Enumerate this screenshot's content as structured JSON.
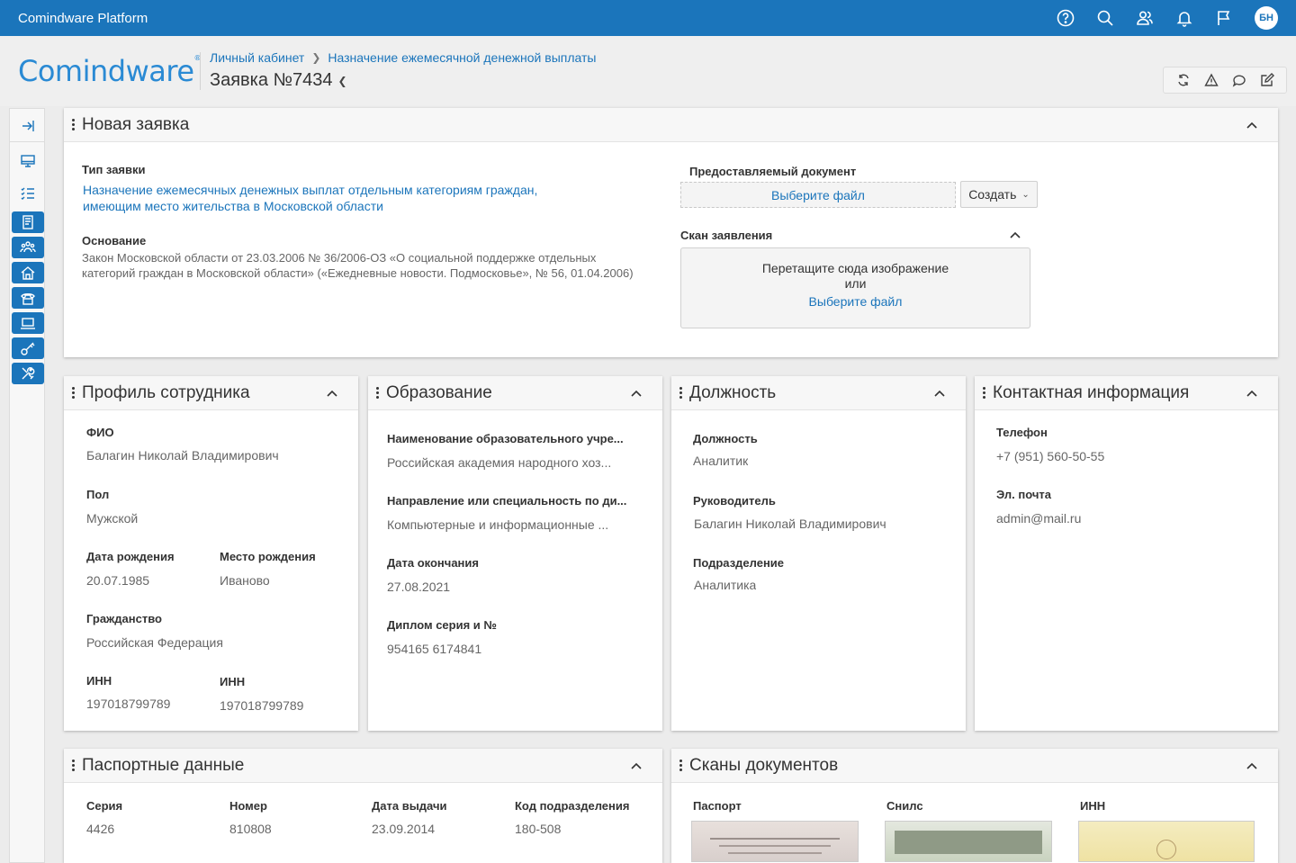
{
  "topbar": {
    "app_title": "Comindware Platform",
    "icons": [
      "help-icon",
      "search-icon",
      "users-icon",
      "bell-icon",
      "flag-icon"
    ],
    "avatar_initials": "БН"
  },
  "header": {
    "logo": "Comindware",
    "breadcrumb": [
      "Личный кабинет",
      "Назначение ежемесячной денежной выплаты"
    ],
    "title": "Заявка №7434",
    "toolbar_icons": [
      "refresh-icon",
      "warning-icon",
      "comment-icon",
      "edit-icon"
    ]
  },
  "new_request": {
    "title": "Новая заявка",
    "type_label": "Тип заявки",
    "type_value_line1": "Назначение ежемесячных денежных выплат отдельным категориям граждан,",
    "type_value_line2": "имеющим место жительства в Московской области",
    "basis_label": "Основание",
    "basis_value_line1": "Закон Московской области от 23.03.2006 № 36/2006-ОЗ «О социальной поддержке отдельных",
    "basis_value_line2": "категорий граждан в Московской области» («Ежедневные новости. Подмосковье», № 56, 01.04.2006)",
    "doc_label": "Предоставляемый документ",
    "choose_file": "Выберите файл",
    "create_button": "Создать",
    "scan_label": "Скан заявления",
    "drop_text": "Перетащите сюда изображение",
    "drop_or": "или",
    "drop_link": "Выберите файл"
  },
  "profile": {
    "title": "Профиль сотрудника",
    "fio_label": "ФИО",
    "fio_value": "Балагин Николай Владимирович",
    "gender_label": "Пол",
    "gender_value": "Мужской",
    "birthdate_label": "Дата рождения",
    "birthdate_value": "20.07.1985",
    "birthplace_label": "Место рождения",
    "birthplace_value": "Иваново",
    "citizenship_label": "Гражданство",
    "citizenship_value": "Российская Федерация",
    "inn1_label": "ИНН",
    "inn1_value": "197018799789",
    "inn2_label": "ИНН",
    "inn2_value": "197018799789"
  },
  "education": {
    "title": "Образование",
    "institution_label": "Наименование образовательного учре...",
    "institution_value": "Российская академия народного хоз...",
    "specialty_label": "Направление или специальность по ди...",
    "specialty_value": "Компьютерные и информационные ...",
    "end_date_label": "Дата окончания",
    "end_date_value": "27.08.2021",
    "diploma_label": "Диплом серия и №",
    "diploma_value": "954165 6174841"
  },
  "position": {
    "title": "Должность",
    "position_label": "Должность",
    "position_value": "Аналитик",
    "manager_label": "Руководитель",
    "manager_value": "Балагин Николай Владимирович",
    "department_label": "Подразделение",
    "department_value": "Аналитика"
  },
  "contacts": {
    "title": "Контактная информация",
    "phone_label": "Телефон",
    "phone_value": "+7 (951) 560-50-55",
    "email_label": "Эл. почта",
    "email_value": "admin@mail.ru"
  },
  "passport": {
    "title": "Паспортные данные",
    "series_label": "Серия",
    "series_value": "4426",
    "number_label": "Номер",
    "number_value": "810808",
    "issue_label": "Дата выдачи",
    "issue_value": "23.09.2014",
    "code_label": "Код подразделения",
    "code_value": "180-508"
  },
  "scans": {
    "title": "Сканы документов",
    "passport_label": "Паспорт",
    "snils_label": "Снилс",
    "inn_label": "ИНН"
  },
  "colors": {
    "brand": "#1b75bb",
    "background": "#ececec"
  }
}
